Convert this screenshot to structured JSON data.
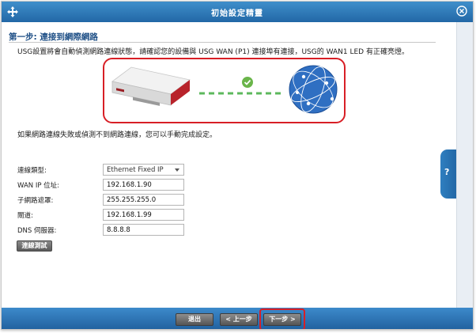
{
  "window": {
    "title": "初始設定精靈"
  },
  "step": {
    "title": "第一步: 連接到網際網路",
    "description": "USG設置將會自動偵測網路連線狀態，請確認您的設備與 USG WAN (P1) 連接埠有連接，USG的 WAN1 LED 有正確亮燈。",
    "fail_message": "如果網路連線失敗或偵測不到網路連線，您可以手動完成設定。"
  },
  "form": {
    "connection_type": {
      "label": "連線類型:",
      "value": "Ethernet Fixed IP"
    },
    "wan_ip": {
      "label": "WAN IP 位址:",
      "value": "192.168.1.90"
    },
    "subnet_mask": {
      "label": "子網路遮罩:",
      "value": "255.255.255.0"
    },
    "gateway": {
      "label": "閘道:",
      "value": "192.168.1.99"
    },
    "dns": {
      "label": "DNS 伺服器:",
      "value": "8.8.8.8"
    },
    "test_label": "連線測試"
  },
  "help": {
    "label": "?"
  },
  "footer": {
    "exit_label": "退出",
    "prev_label": "< 上一步",
    "next_label": "下一步 >"
  },
  "colors": {
    "title_bar": "#2267a6",
    "highlight": "#d81f26",
    "link_dash": "#5cb85c",
    "check": "#6ab54a",
    "globe": "#2f6fc2",
    "router_red": "#b8232b"
  },
  "icons": {
    "move": "move-icon",
    "close": "close-icon",
    "check": "check-icon",
    "globe": "globe-icon",
    "router": "router-icon"
  }
}
